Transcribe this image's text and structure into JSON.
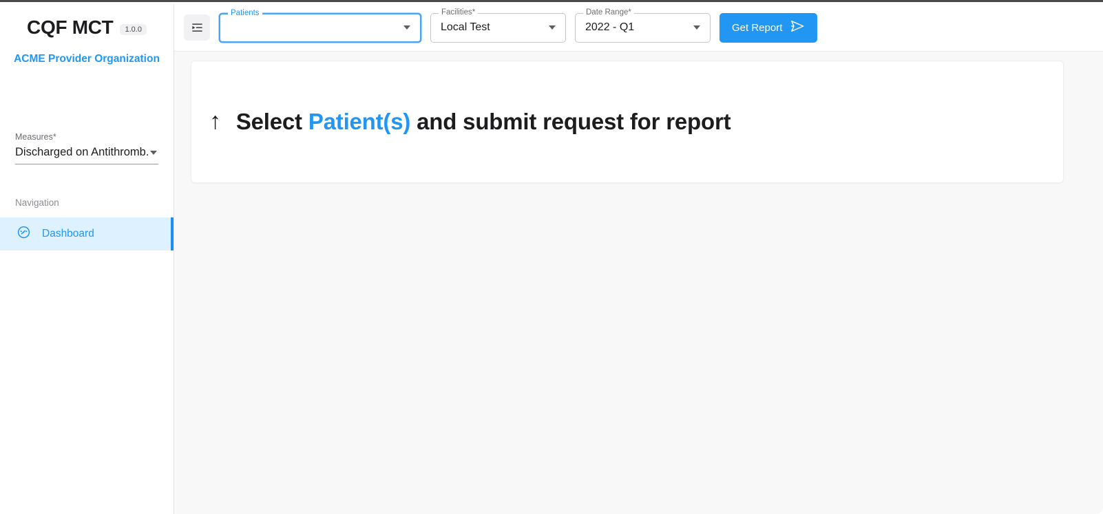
{
  "sidebar": {
    "brand": "CQF MCT",
    "version": "1.0.0",
    "organization": "ACME Provider Organization",
    "measures": {
      "label": "Measures",
      "required_marker": "*",
      "value": "Discharged on Antithromb...",
      "icon": "chevron-down-icon"
    },
    "navigation_heading": "Navigation",
    "nav_items": [
      {
        "label": "Dashboard",
        "icon": "speedometer-icon",
        "active": true
      }
    ]
  },
  "toolbar": {
    "menu_toggle_icon": "menu-open-icon",
    "fields": [
      {
        "name": "patients",
        "legend": "Patients",
        "required_marker": "",
        "value": "",
        "placeholder": "",
        "focused": true,
        "icon": "chevron-down-icon"
      },
      {
        "name": "facilities",
        "legend": "Facilities",
        "required_marker": "*",
        "value": "Local Test",
        "placeholder": "",
        "focused": false,
        "icon": "chevron-down-icon"
      },
      {
        "name": "date-range",
        "legend": "Date Range",
        "required_marker": "*",
        "value": "2022 - Q1",
        "placeholder": "",
        "focused": false,
        "icon": "chevron-down-icon"
      }
    ],
    "get_report_label": "Get Report",
    "get_report_icon": "send-icon"
  },
  "main": {
    "empty_state": {
      "arrow_icon": "arrow-up-icon",
      "text_before": "Select ",
      "highlight": "Patient(s)",
      "text_after": " and submit request for report"
    }
  },
  "colors": {
    "accent": "#2196f3",
    "active_nav_bg": "#ddf1fe",
    "active_nav_indicator": "#1f8ef1",
    "page_bg": "#f8f8f9",
    "surface": "#ffffff",
    "text_primary": "#1d1d1f",
    "text_muted": "#6d6d72",
    "border": "#c6c6ca",
    "focus_border": "#4ba4f5",
    "badge_bg": "#f0f0f2"
  }
}
